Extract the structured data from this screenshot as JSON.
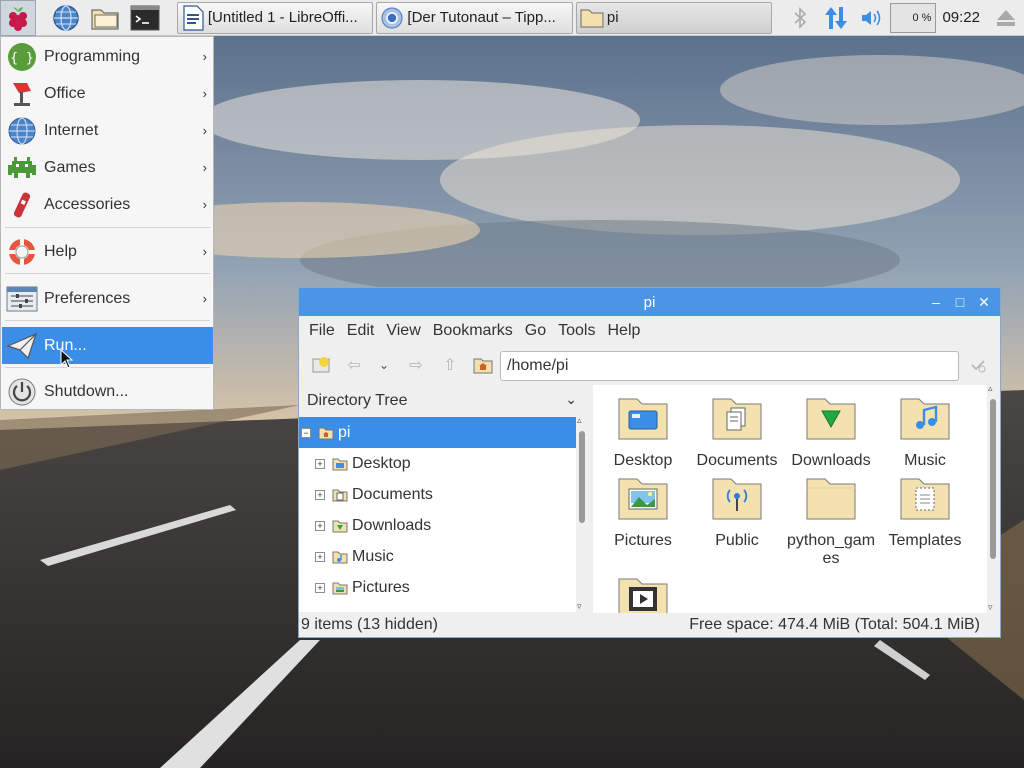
{
  "panel": {
    "launchers": [
      {
        "icon": "raspberry-icon",
        "name": "menu-button"
      },
      {
        "icon": "globe-icon",
        "name": "web-browser-launcher"
      },
      {
        "icon": "folder-icon",
        "name": "file-manager-launcher"
      },
      {
        "icon": "terminal-icon",
        "name": "terminal-launcher"
      }
    ],
    "tasks": [
      {
        "label": "[Untitled 1 - LibreOffi...",
        "icon": "writer-document-icon"
      },
      {
        "label": "[Der Tutonaut – Tipp...",
        "icon": "chromium-icon"
      },
      {
        "label": "pi",
        "icon": "folder-icon"
      }
    ],
    "cpu_label": "0 %",
    "clock": "09:22"
  },
  "menu": {
    "items": [
      {
        "label": "Programming",
        "icon": "programming-icon",
        "submenu": true
      },
      {
        "label": "Office",
        "icon": "office-icon",
        "submenu": true
      },
      {
        "label": "Internet",
        "icon": "internet-icon",
        "submenu": true
      },
      {
        "label": "Games",
        "icon": "games-icon",
        "submenu": true
      },
      {
        "label": "Accessories",
        "icon": "accessories-icon",
        "submenu": true
      },
      {
        "label": "Help",
        "icon": "help-icon",
        "submenu": true
      },
      {
        "label": "Preferences",
        "icon": "preferences-icon",
        "submenu": true
      },
      {
        "label": "Run...",
        "icon": "run-icon",
        "submenu": false,
        "selected": true
      },
      {
        "label": "Shutdown...",
        "icon": "shutdown-icon",
        "submenu": false
      }
    ],
    "submenu_arrow": "›"
  },
  "file_manager": {
    "title": "pi",
    "window_buttons": {
      "minimize": "–",
      "maximize": "□",
      "close": "✕"
    },
    "menubar": [
      "File",
      "Edit",
      "View",
      "Bookmarks",
      "Go",
      "Tools",
      "Help"
    ],
    "path": "/home/pi",
    "sidebar": {
      "header": "Directory Tree",
      "tree": [
        {
          "label": "pi",
          "expander": "−",
          "selected": true
        },
        {
          "label": "Desktop",
          "expander": "+"
        },
        {
          "label": "Documents",
          "expander": "+"
        },
        {
          "label": "Downloads",
          "expander": "+"
        },
        {
          "label": "Music",
          "expander": "+"
        },
        {
          "label": "Pictures",
          "expander": "+"
        }
      ]
    },
    "folders": [
      {
        "label": "Desktop",
        "icon": "desktop-folder-icon"
      },
      {
        "label": "Documents",
        "icon": "documents-folder-icon"
      },
      {
        "label": "Downloads",
        "icon": "downloads-folder-icon"
      },
      {
        "label": "Music",
        "icon": "music-folder-icon"
      },
      {
        "label": "Pictures",
        "icon": "pictures-folder-icon"
      },
      {
        "label": "Public",
        "icon": "public-folder-icon"
      },
      {
        "label": "python_games",
        "icon": "folder-icon"
      },
      {
        "label": "Templates",
        "icon": "templates-folder-icon"
      },
      {
        "label": "",
        "icon": "videos-folder-icon"
      }
    ],
    "status_left": "9 items (13 hidden)",
    "status_right": "Free space: 474.4 MiB (Total: 504.1 MiB)"
  },
  "colors": {
    "accent": "#3b8ee8",
    "titlebar": "#4a95e6",
    "folder": "#f3e2b0"
  }
}
